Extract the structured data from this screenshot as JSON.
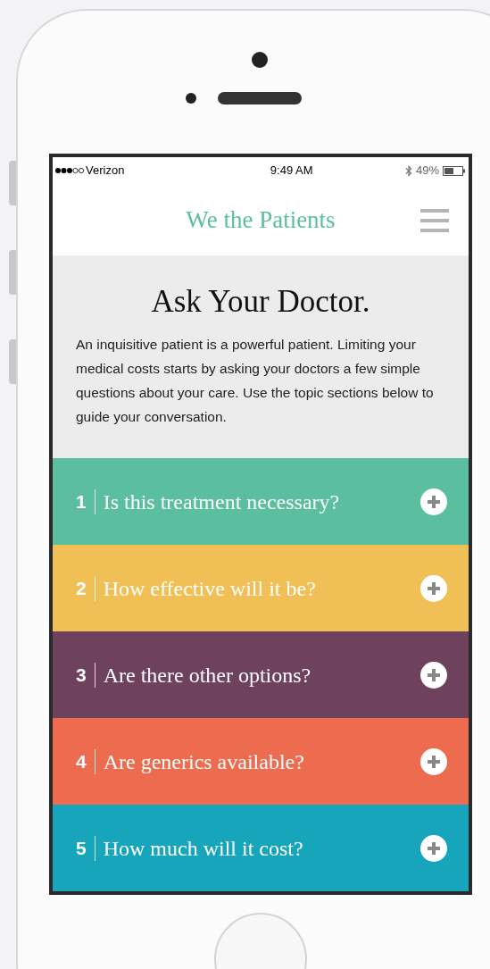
{
  "status_bar": {
    "carrier": "Verizon",
    "time": "9:49 AM",
    "battery": "49%"
  },
  "header": {
    "logo": "We the Patients"
  },
  "intro": {
    "title": "Ask Your Doctor.",
    "text": "An inquisitive patient is a powerful patient. Limiting your medical costs starts by asking your doctors a few simple questions about your care. Use the topic sections below to guide your conversation."
  },
  "sections": [
    {
      "number": "1",
      "question": "Is this treatment necessary?",
      "color": "#5bbf9f",
      "expanded": false
    },
    {
      "number": "2",
      "question": "How effective will it be?",
      "color": "#f0bf56",
      "expanded": false
    },
    {
      "number": "3",
      "question": "Are there other options?",
      "color": "#6e425c",
      "expanded": false
    },
    {
      "number": "4",
      "question": "Are generics available?",
      "color": "#ed6c50",
      "expanded": false
    },
    {
      "number": "5",
      "question": "How much will it cost?",
      "color": "#16a5bb",
      "expanded": false
    }
  ]
}
